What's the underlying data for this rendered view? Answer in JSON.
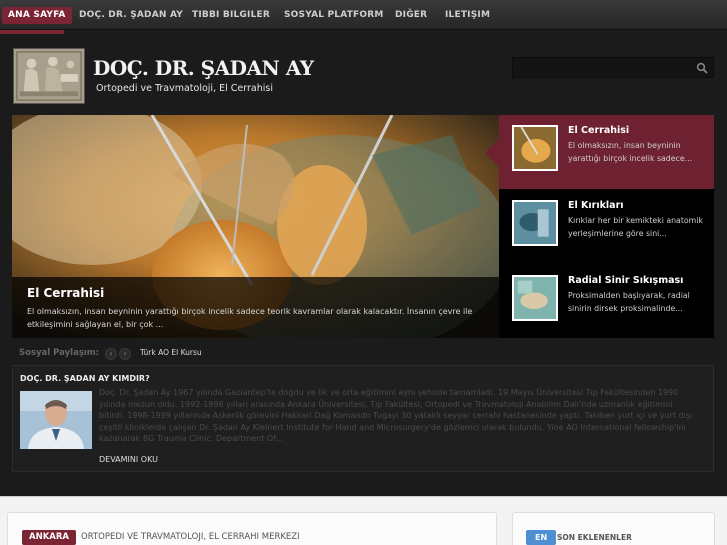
{
  "nav": {
    "items": [
      {
        "label": "ANA SAYFA",
        "active": true
      },
      {
        "label": "DOÇ. DR. ŞADAN AY"
      },
      {
        "label": "TIBBI BILGILER"
      },
      {
        "label": "SOSYAL PLATFORM"
      },
      {
        "label": "DIĞER"
      },
      {
        "label": "ILETIŞIM"
      }
    ]
  },
  "header": {
    "title": "DOÇ. DR. ŞADAN AY",
    "subtitle": "Ortopedi ve Travmatoloji, El  Cerrahisi",
    "search_value": ""
  },
  "slider": {
    "main": {
      "title": "El Cerrahisi",
      "text": "El olmaksızın, insan beyninin yarattığı birçok incelik sadece teorik kavramlar olarak kalacaktır. İnsanın çevre ile etkileşimini sağlayan el, bir çok ..."
    },
    "thumbs": [
      {
        "title": "El Cerrahisi",
        "text": "El olmaksızın, insan beyninin yarattığı birçok incelik sadece...",
        "active": true
      },
      {
        "title": "El Kırıkları",
        "text": "Kırıklar her bir kemikteki anatomik yerleşimlerine göre sini..."
      },
      {
        "title": "Radial Sinir Sıkışması",
        "text": "Proksimalden başlıyarak, radial sinirin dirsek proksimalinde..."
      }
    ]
  },
  "share": {
    "label": "Sosyal Paylaşım:",
    "prev": "‹",
    "next": "›",
    "link": "Türk AO El Kursu"
  },
  "about": {
    "title": "DOÇ. DR. ŞADAN AY KIMDIR?",
    "text": "Doç. Dr. Şadan Ay 1967 yılında Gaziantep'te doğdu ve ilk ve orta eğitimini aynı şehirde tamamladı. 19 Mayıs Üniversitesi Tıp Fakültesinden 1990 yılında mezun oldu. 1992-1996 yılları arasında Ankara Üniversitesi, Tıp Fakültesi, Ortopedi ve Travmatoloji Anabilim Dalı'nda uzmanlık eğitimini bitirdi. 1998-1999 yıllarında Askerlik görevini Hakkari Dağ Komando Tugayı 30 yataklı seyyar cerrahi hastanesinde yaptı. Takiben yurt içi ve  yurt dışı çeşitli kliniklerde çalışan Dr. Şadan Ay Kleinert Institute for Hand and Microsurgery'de gözlemci olarak bulundu. Yine AO International fellowship'ini kazanarak BG Trauma Clinic, Department Of...",
    "read_more": "DEVAMINI OKU"
  },
  "bottom": {
    "badge": "ANKARA",
    "heading": "ORTOPEDI VE TRAVMATOLOJI, EL CERRAHI MERKEZI",
    "lang_button": "EN",
    "recent_label": "SON EKLENENLER"
  },
  "colors": {
    "accent": "#7a2434",
    "thumb_active": "#6e2231",
    "en_button": "#4d8fd1"
  },
  "icons": {
    "search": "search-icon",
    "logo": "relief-logo-icon"
  }
}
